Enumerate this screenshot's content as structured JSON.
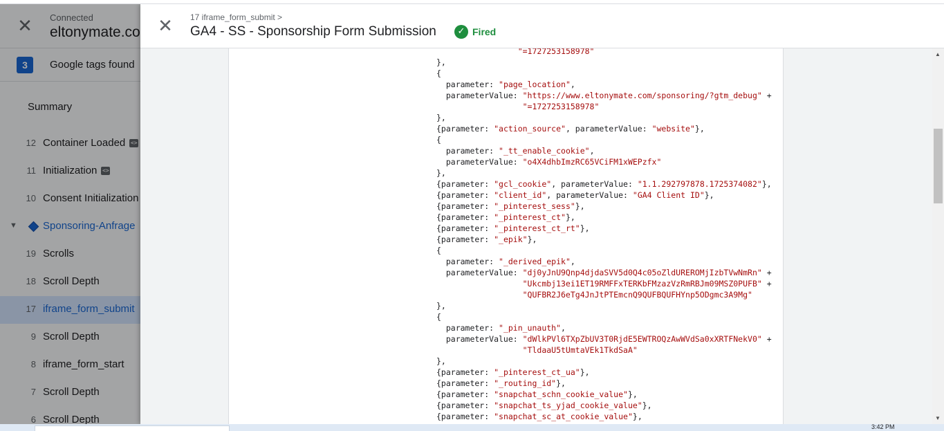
{
  "left": {
    "connected_label": "Connected",
    "domain": "eltonymate.com",
    "tags_count": "3",
    "tags_label": "Google tags found",
    "summary_label": "Summary",
    "code_badge": "<>",
    "events": [
      {
        "num": "12",
        "label": "Container Loaded",
        "badge": true
      },
      {
        "num": "11",
        "label": "Initialization",
        "badge": true
      },
      {
        "num": "10",
        "label": "Consent Initialization",
        "badge": false
      },
      {
        "num": "",
        "label": "Sponsoring-Anfrage",
        "group": true
      },
      {
        "num": "19",
        "label": "Scrolls"
      },
      {
        "num": "18",
        "label": "Scroll Depth"
      },
      {
        "num": "17",
        "label": "iframe_form_submit",
        "selected": true
      },
      {
        "num": "9",
        "label": "Scroll Depth"
      },
      {
        "num": "8",
        "label": "iframe_form_start"
      },
      {
        "num": "7",
        "label": "Scroll Depth"
      },
      {
        "num": "6",
        "label": "Scroll Depth"
      }
    ]
  },
  "dialog": {
    "breadcrumb": "17 iframe_form_submit >",
    "title": "GA4 - SS - Sponsorship Form Submission",
    "status": "Fired",
    "status_color": "#1e8e3e"
  },
  "code_lines": [
    "                 \"=1727253158978\"",
    "},",
    "{",
    "  parameter: \"page_location\",",
    "  parameterValue: \"https://www.eltonymate.com/sponsoring/?gtm_debug\" +",
    "                  \"=1727253158978\"",
    "},",
    "{parameter: \"action_source\", parameterValue: \"website\"},",
    "{",
    "  parameter: \"_tt_enable_cookie\",",
    "  parameterValue: \"o4X4dhbImzRC65VCiFM1xWEPzfx\"",
    "},",
    "{parameter: \"gcl_cookie\", parameterValue: \"1.1.292797878.1725374082\"},",
    "{parameter: \"client_id\", parameterValue: \"GA4 Client ID\"},",
    "{parameter: \"_pinterest_sess\"},",
    "{parameter: \"_pinterest_ct\"},",
    "{parameter: \"_pinterest_ct_rt\"},",
    "{parameter: \"_epik\"},",
    "{",
    "  parameter: \"_derived_epik\",",
    "  parameterValue: \"dj0yJnU9Qnp4djdaSVV5d0Q4c05oZldUREROMjIzbTVwNmRn\" +",
    "                  \"Ukcmbj13ei1ET19RMFFxTERKbFMzazVzRmRBJm09MSZ0PUFB\" +",
    "                  \"QUFBR2J6eTg4JnJtPTEmcnQ9QUFBQUFHYnp5ODgmc3A9Mg\"",
    "},",
    "{",
    "  parameter: \"_pin_unauth\",",
    "  parameterValue: \"dWlkPVl6TXpZbUV3T0RjdE5EWTROQzAwWVdSa0xXRTFNekV0\" +",
    "                  \"TldaaU5tUmtaVEk1TkdSaA\"",
    "},",
    "{parameter: \"_pinterest_ct_ua\"},",
    "{parameter: \"_routing_id\"},",
    "{parameter: \"snapchat_schn_cookie_value\"},",
    "{parameter: \"snapchat_ts_yjad_cookie_value\"},",
    "{parameter: \"snapchat_sc_at_cookie_value\"},"
  ],
  "taskbar": {
    "clock": "3:42 PM"
  }
}
